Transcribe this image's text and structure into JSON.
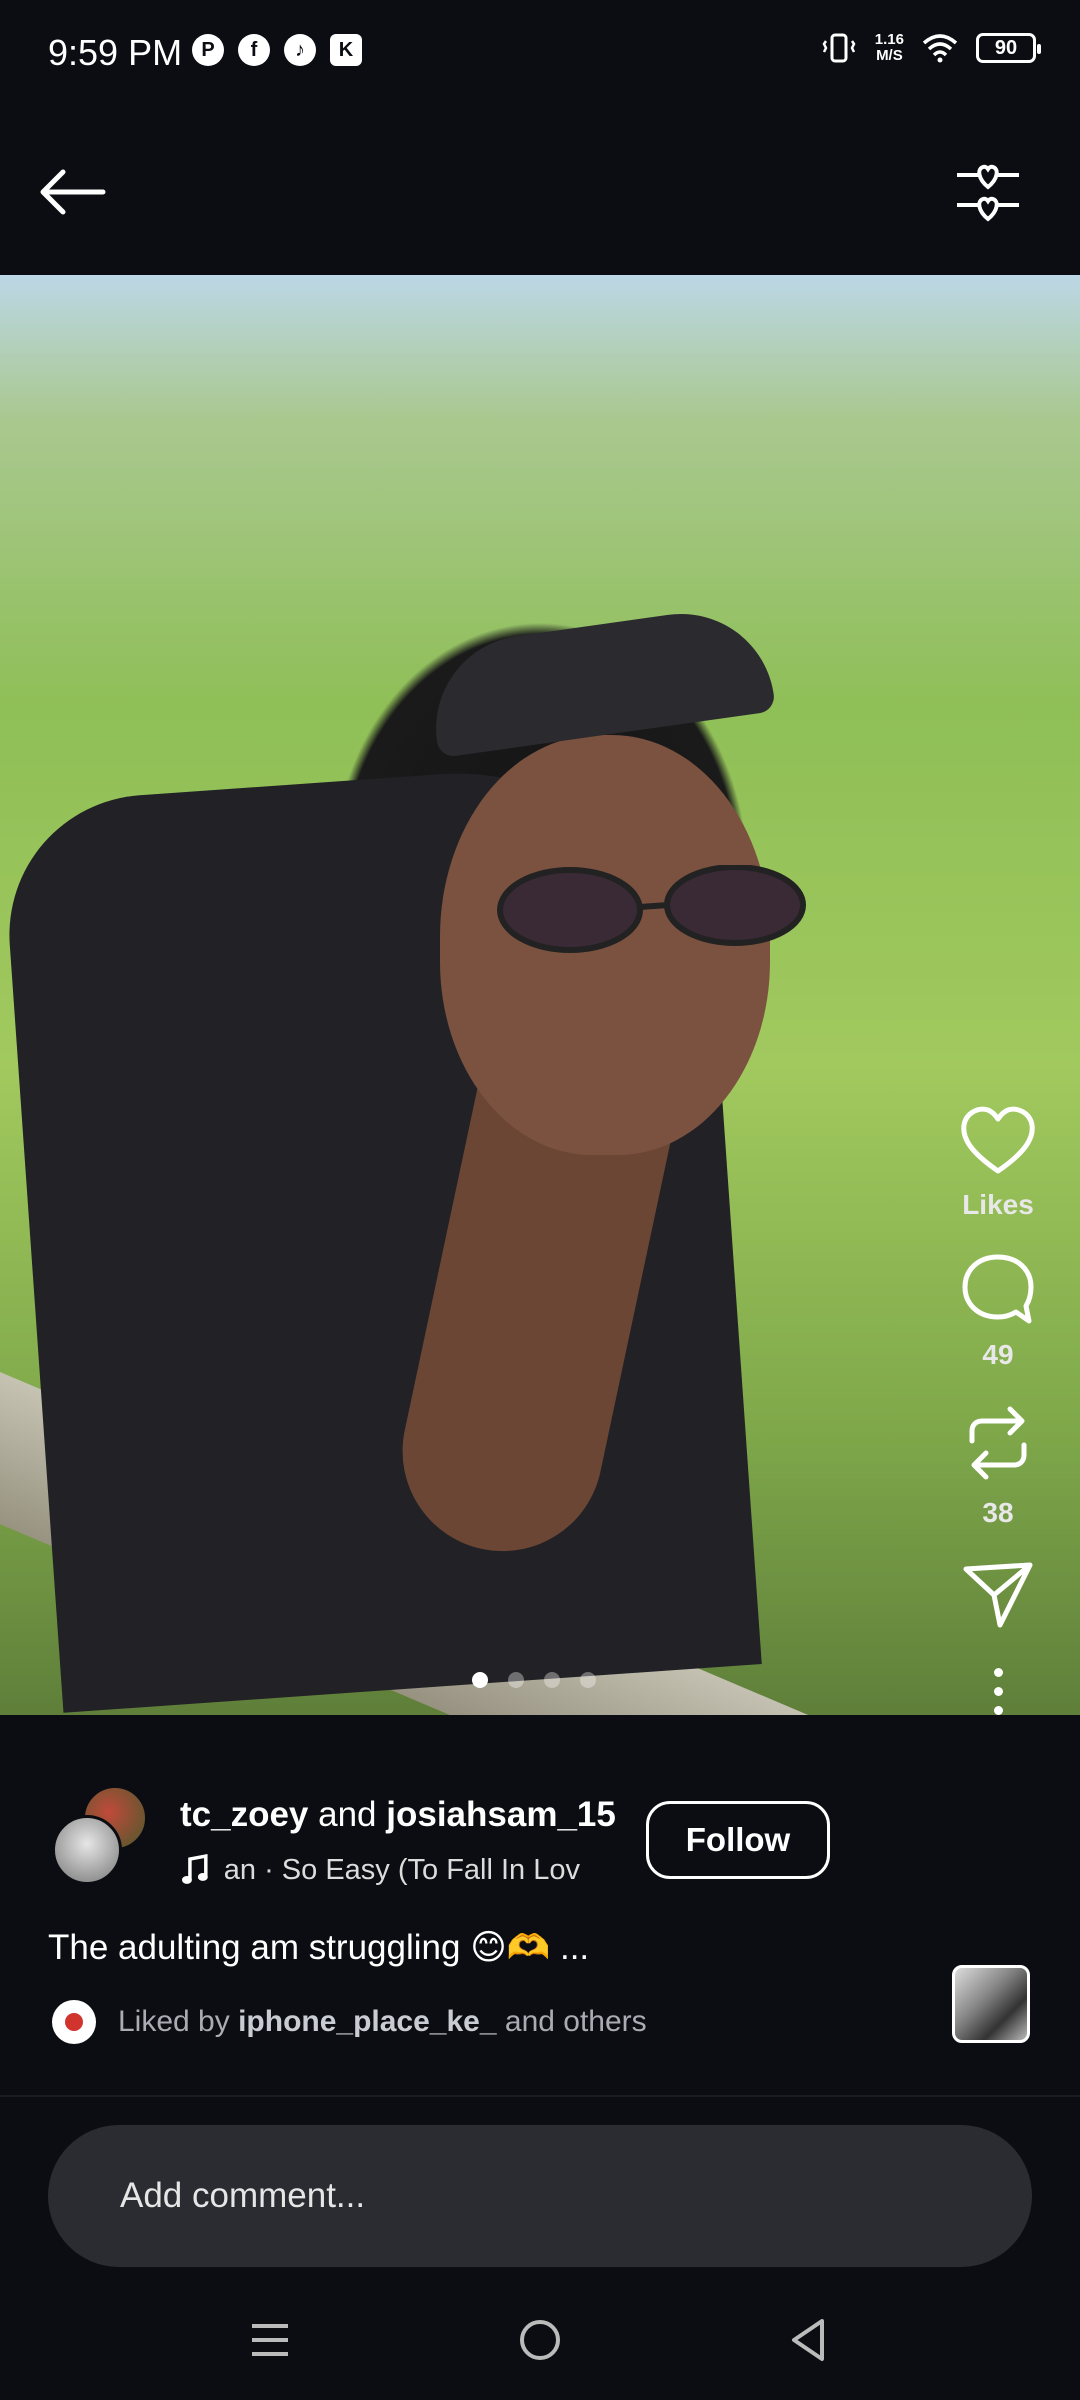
{
  "status_bar": {
    "time": "9:59 PM",
    "app_icons": [
      "pinterest-icon",
      "facebook-icon",
      "tiktok-icon",
      "shop-icon"
    ],
    "network_speed_value": "1.16",
    "network_speed_unit": "M/S",
    "battery": "90"
  },
  "top_bar": {
    "back_icon": "arrow-left-icon",
    "filter_icon": "heart-filter-icon"
  },
  "carousel": {
    "total": 4,
    "active_index": 0
  },
  "actions": {
    "likes_label": "Likes",
    "comments_count": "49",
    "reposts_count": "38"
  },
  "post": {
    "author_1": "tc_zoey",
    "connector": " and ",
    "author_2": "josiahsam_15",
    "music": "an · So Easy (To Fall In Lov",
    "follow_label": "Follow",
    "caption": "The adulting am struggling 😊🫶 ...",
    "liked_prefix": "Liked by ",
    "liked_user": "iphone_place_ke_",
    "liked_suffix": " and others"
  },
  "comment": {
    "placeholder": "Add comment..."
  },
  "colors": {
    "background": "#0b0d12",
    "input": "#2a2c31",
    "muted_text": "#a9acb3"
  }
}
